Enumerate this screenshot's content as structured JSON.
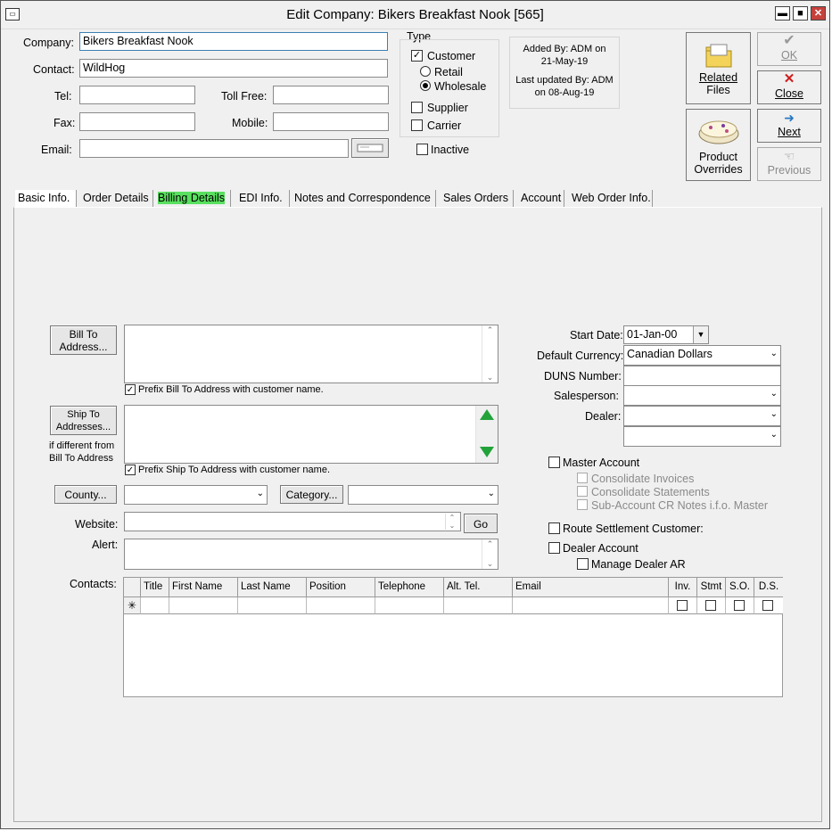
{
  "window": {
    "title": "Edit Company: Bikers Breakfast Nook [565]",
    "min_glyph": "▬",
    "max_glyph": "■",
    "close_glyph": "✕"
  },
  "form": {
    "company_label": "Company:",
    "company_value": "Bikers Breakfast Nook",
    "contact_label": "Contact:",
    "contact_value": "WildHog",
    "tel_label": "Tel:",
    "tel_value": "",
    "tollfree_label": "Toll Free:",
    "tollfree_value": "",
    "fax_label": "Fax:",
    "fax_value": "",
    "mobile_label": "Mobile:",
    "mobile_value": "",
    "email_label": "Email:",
    "email_value": ""
  },
  "type_group": {
    "title": "Type",
    "customer": "Customer",
    "retail": "Retail",
    "wholesale": "Wholesale",
    "supplier": "Supplier",
    "carrier": "Carrier",
    "inactive": "Inactive"
  },
  "audit": {
    "added_by": "Added By: ADM on",
    "added_date": "21-May-19",
    "updated_by": "Last updated By: ADM",
    "updated_date": "on 08-Aug-19"
  },
  "side_buttons": {
    "related_line1": "Related",
    "related_line2": "Files",
    "product_line1": "Product",
    "product_line2": "Overrides",
    "ok": "OK",
    "close": "Close",
    "next": "Next",
    "previous": "Previous"
  },
  "tabs": [
    {
      "label": "Basic Info."
    },
    {
      "label": "Order Details"
    },
    {
      "label": "Billing Details"
    },
    {
      "label": "EDI Info."
    },
    {
      "label": "Notes and Correspondence"
    },
    {
      "label": "Sales Orders"
    },
    {
      "label": "Account"
    },
    {
      "label": "Web Order Info."
    }
  ],
  "billing": {
    "bill_to_btn": [
      "Bill To",
      "Address..."
    ],
    "prefix_bill": "Prefix Bill To Address with customer name.",
    "ship_to_btn": [
      "Ship To",
      "Addresses..."
    ],
    "ship_note": [
      "if different from",
      "Bill To Address"
    ],
    "prefix_ship": "Prefix Ship To Address with customer name.",
    "county_btn": "County...",
    "category_btn": "Category...",
    "website_label": "Website:",
    "go_btn": "Go",
    "alert_label": "Alert:",
    "contacts_label": "Contacts:"
  },
  "right_fields": {
    "start_date_label": "Start Date:",
    "start_date_value": "01-Jan-00",
    "currency_label": "Default Currency:",
    "currency_value": "Canadian Dollars",
    "duns_label": "DUNS Number:",
    "salesperson_label": "Salesperson:",
    "dealer_label": "Dealer:",
    "master_account": "Master Account",
    "consolidate_invoices": "Consolidate Invoices",
    "consolidate_statements": "Consolidate Statements",
    "sub_account": "Sub-Account CR Notes i.f.o. Master",
    "route_settlement": "Route Settlement Customer:",
    "dealer_account": "Dealer Account",
    "manage_dealer_ar": "Manage Dealer AR"
  },
  "contacts_grid": {
    "columns": [
      "Title",
      "First Name",
      "Last Name",
      "Position",
      "Telephone",
      "Alt. Tel.",
      "Email",
      "Inv.",
      "Stmt",
      "S.O.",
      "D.S."
    ],
    "new_row_marker": "✳"
  }
}
